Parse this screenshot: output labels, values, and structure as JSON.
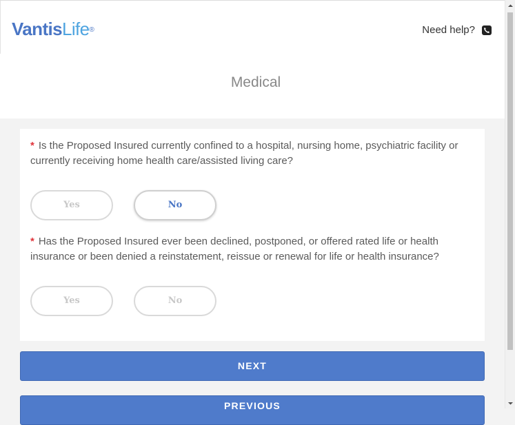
{
  "header": {
    "logo_vantis": "Vantis",
    "logo_life": "Life",
    "logo_reg": "®",
    "help_text": "Need help?",
    "help_icon": "phone-icon"
  },
  "page": {
    "title": "Medical"
  },
  "questions": [
    {
      "required_mark": "*",
      "text": "Is the Proposed Insured currently confined to a hospital, nursing home, psychiatric facility or currently receiving home health care/assisted living care?",
      "yes_label": "Yes",
      "no_label": "No",
      "selected": "No"
    },
    {
      "required_mark": "*",
      "text": "Has the Proposed Insured ever been declined, postponed, or offered rated life or health insurance or been denied a reinstatement, reissue or renewal for life or health insurance?",
      "yes_label": "Yes",
      "no_label": "No",
      "selected": null
    }
  ],
  "actions": {
    "next_label": "NEXT",
    "previous_label": "PREVIOUS"
  },
  "colors": {
    "brand_primary": "#4a76c5",
    "brand_secondary": "#4ea4e0",
    "button": "#4f7bcb",
    "required": "#e0343b"
  }
}
